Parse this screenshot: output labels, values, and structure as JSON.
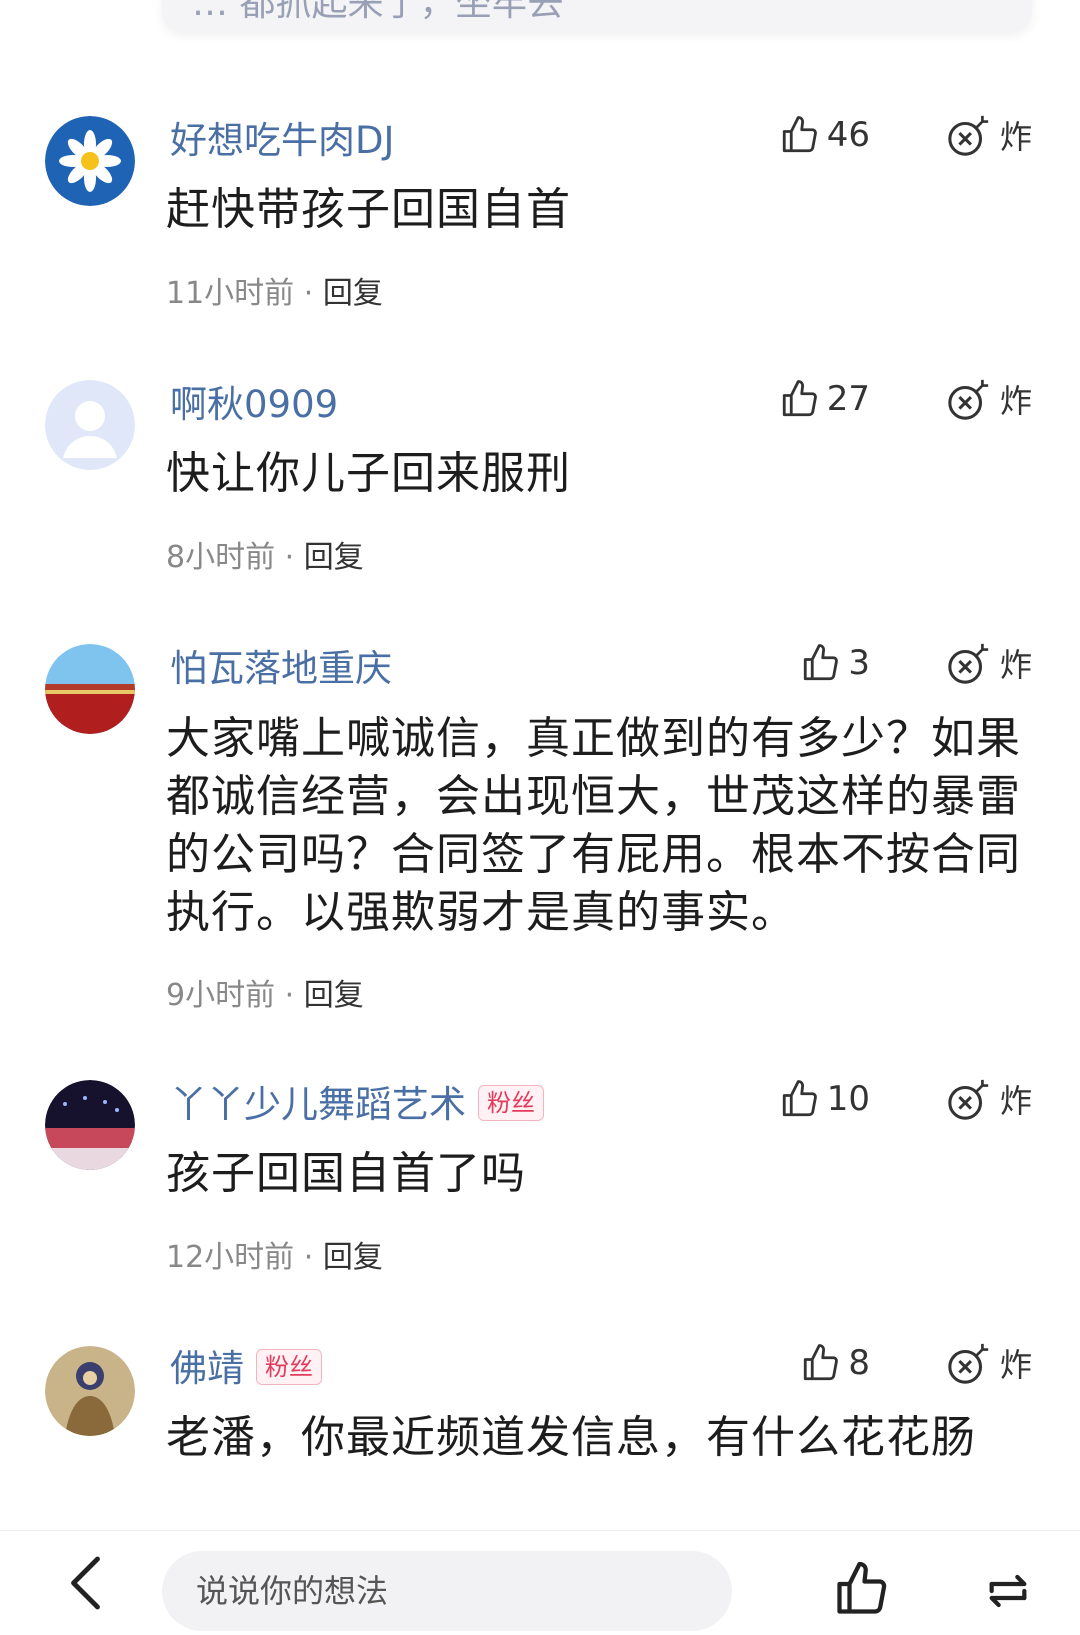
{
  "top_card": {
    "text": "… 都抓起来了，坐牢去"
  },
  "comments": [
    {
      "username": "好想吃牛肉DJ",
      "badge": "",
      "likes": "46",
      "bomb_label": "炸",
      "content": "赶快带孩子回国自首",
      "time": "11小时前",
      "reply": "回复"
    },
    {
      "username": "啊秋0909",
      "badge": "",
      "likes": "27",
      "bomb_label": "炸",
      "content": "快让你儿子回来服刑",
      "time": "8小时前",
      "reply": "回复"
    },
    {
      "username": "怕瓦落地重庆",
      "badge": "",
      "likes": "3",
      "bomb_label": "炸",
      "content": "大家嘴上喊诚信，真正做到的有多少？如果都诚信经营，会出现恒大，世茂这样的暴雷的公司吗？合同签了有屁用。根本不按合同执行。以强欺弱才是真的事实。",
      "time": "9小时前",
      "reply": "回复"
    },
    {
      "username": "丫丫少儿舞蹈艺术",
      "badge": "粉丝",
      "likes": "10",
      "bomb_label": "炸",
      "content": "孩子回国自首了吗",
      "time": "12小时前",
      "reply": "回复"
    },
    {
      "username": "佛靖",
      "badge": "粉丝",
      "likes": "8",
      "bomb_label": "炸",
      "content": "老潘，你最近频道发信息，有什么花花肠",
      "time": "",
      "reply": ""
    }
  ],
  "bottom_bar": {
    "input_placeholder": "说说你的想法",
    "icons": [
      "back-icon",
      "thumbs-up-icon",
      "share-icon"
    ]
  },
  "colors": {
    "username": "#4a6fa5",
    "fan_badge": "#e23b5c",
    "input_bg": "#f2f2f4"
  }
}
